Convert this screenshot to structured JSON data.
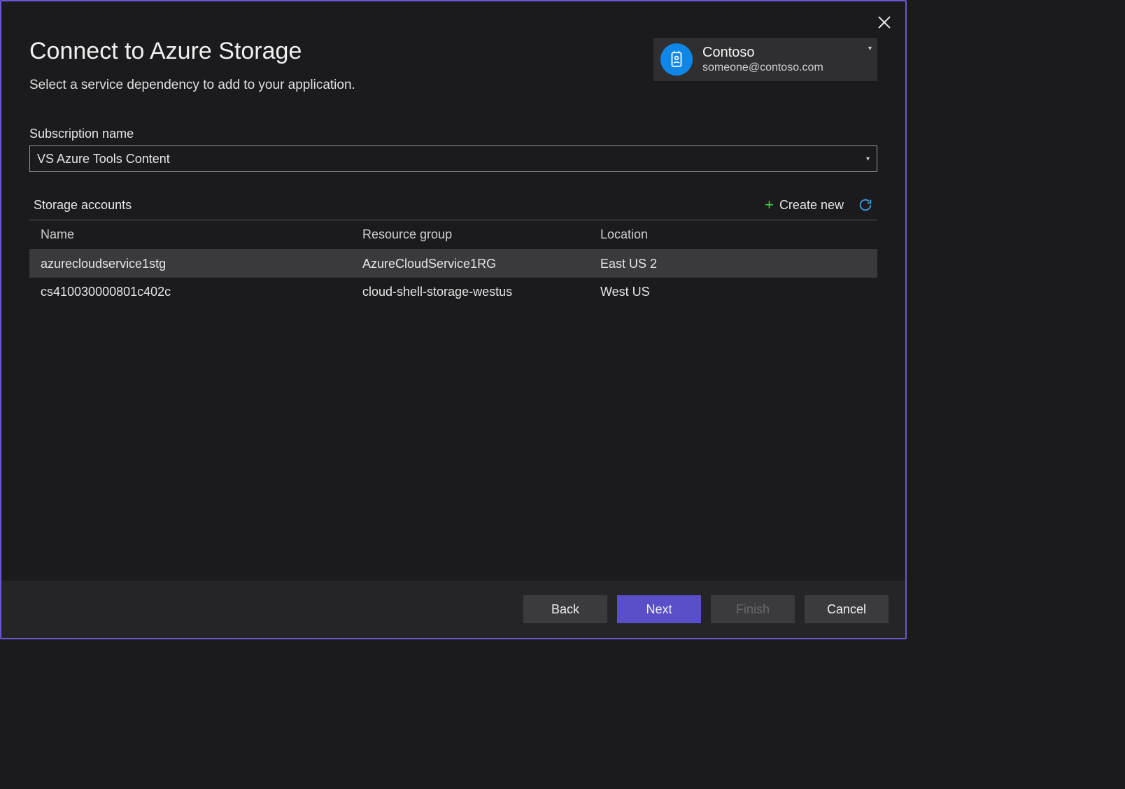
{
  "dialog": {
    "title": "Connect to Azure Storage",
    "subtitle": "Select a service dependency to add to your application."
  },
  "account": {
    "org_name": "Contoso",
    "email": "someone@contoso.com",
    "icon": "badge-icon"
  },
  "subscription": {
    "label": "Subscription name",
    "selected": "VS Azure Tools Content"
  },
  "storage_list": {
    "title": "Storage accounts",
    "create_new_label": "Create new",
    "columns": {
      "name": "Name",
      "resource_group": "Resource group",
      "location": "Location"
    },
    "rows": [
      {
        "name": "azurecloudservice1stg",
        "resource_group": "AzureCloudService1RG",
        "location": "East US 2",
        "selected": true
      },
      {
        "name": "cs410030000801c402c",
        "resource_group": "cloud-shell-storage-westus",
        "location": "West US",
        "selected": false
      }
    ]
  },
  "buttons": {
    "back": "Back",
    "next": "Next",
    "finish": "Finish",
    "cancel": "Cancel"
  },
  "colors": {
    "accent": "#6b56d6",
    "primary_button": "#5a4fc8",
    "account_icon_bg": "#0f87e8",
    "plus_icon": "#3fd24f",
    "refresh_icon": "#3a9fe6"
  }
}
